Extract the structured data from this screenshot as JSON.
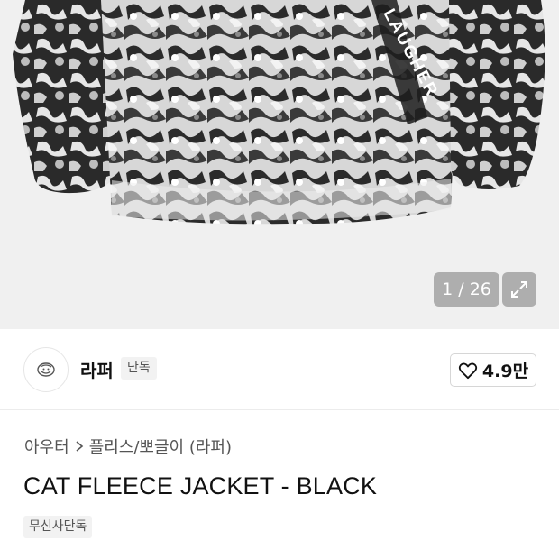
{
  "gallery": {
    "counter": "1 / 26",
    "image_text": "LAUGHER",
    "expand_icon": "expand-arrows-icon"
  },
  "brand": {
    "name": "라퍼",
    "badge": "단독",
    "logo_icon": "brand-logo-icon"
  },
  "like": {
    "icon": "heart-outline-icon",
    "count": "4.9만"
  },
  "breadcrumb": {
    "category": "아우터",
    "subcategory": "플리스/뽀글이 (라퍼)"
  },
  "product": {
    "title": "CAT FLEECE JACKET - BLACK",
    "tag": "무신사단독"
  }
}
